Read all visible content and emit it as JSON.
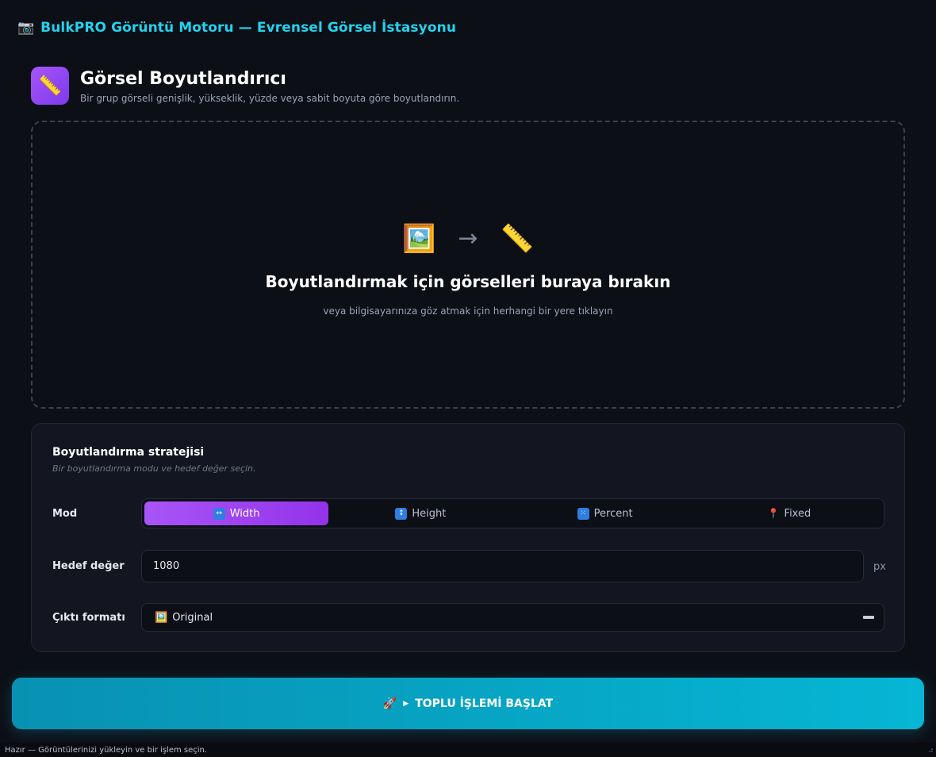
{
  "app": {
    "title": "BulkPRO Görüntü Motoru — Evrensel Görsel İstasyonu",
    "title_icon": "📷"
  },
  "tool": {
    "icon": "📏",
    "title": "Görsel Boyutlandırıcı",
    "subtitle": "Bir grup görseli genişlik, yükseklik, yüzde veya sabit boyuta göre boyutlandırın."
  },
  "dropzone": {
    "icon_left": "🖼️",
    "arrow": "→",
    "icon_right": "📏",
    "title": "Boyutlandırmak için görselleri buraya bırakın",
    "subtitle": "veya bilgisayarınıza göz atmak için herhangi bir yere tıklayın"
  },
  "settings": {
    "title": "Boyutlandırma stratejisi",
    "subtitle": "Bir boyutlandırma modu ve hedef değer seçin.",
    "mode_label": "Mod",
    "modes": [
      {
        "label": "Width",
        "icon": "↔",
        "active": true
      },
      {
        "label": "Height",
        "icon": "↕",
        "active": false
      },
      {
        "label": "Percent",
        "icon": "⁙",
        "active": false
      },
      {
        "label": "Fixed",
        "icon": "📍",
        "active": false
      }
    ],
    "target_label": "Hedef değer",
    "target_value": "1080",
    "target_unit": "px",
    "format_label": "Çıktı formatı",
    "format_icon": "🖼️",
    "format_value": "Original"
  },
  "action": {
    "icon": "🚀",
    "play": "▶",
    "label": "TOPLU İŞLEMİ BAŞLAT"
  },
  "status": {
    "text": "Hazır — Görüntülerinizi yükleyin ve bir işlem seçin."
  },
  "colors": {
    "accent_cyan": "#22d3ee",
    "accent_purple": "#a855f7",
    "background": "#0d0f16"
  }
}
